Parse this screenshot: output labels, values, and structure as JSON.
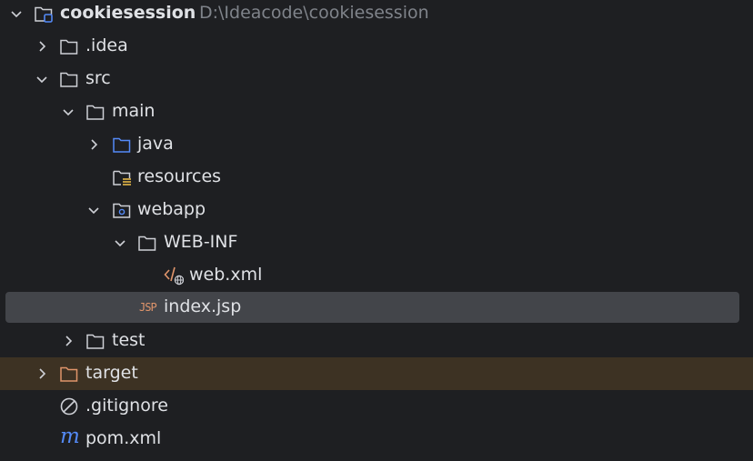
{
  "project": {
    "name": "cookiesession",
    "path": "D:\\Ideacode\\cookiesession"
  },
  "tree": {
    "idea": ".idea",
    "src": "src",
    "main": "main",
    "java": "java",
    "resources": "resources",
    "webapp": "webapp",
    "web_inf": "WEB-INF",
    "web_xml": "web.xml",
    "index_jsp": "index.jsp",
    "test": "test",
    "target": "target",
    "gitignore": ".gitignore",
    "pom_xml": "pom.xml"
  },
  "icons": {
    "jsp_badge": "JSP",
    "maven_badge": "m"
  },
  "colors": {
    "background": "#1e1f22",
    "text": "#dfe1e5",
    "muted_path": "#7f838a",
    "selection": "#43454a",
    "excluded_row": "#3d3223",
    "java_folder": "#548af7",
    "target_folder": "#e0956b",
    "maven": "#548af7"
  }
}
